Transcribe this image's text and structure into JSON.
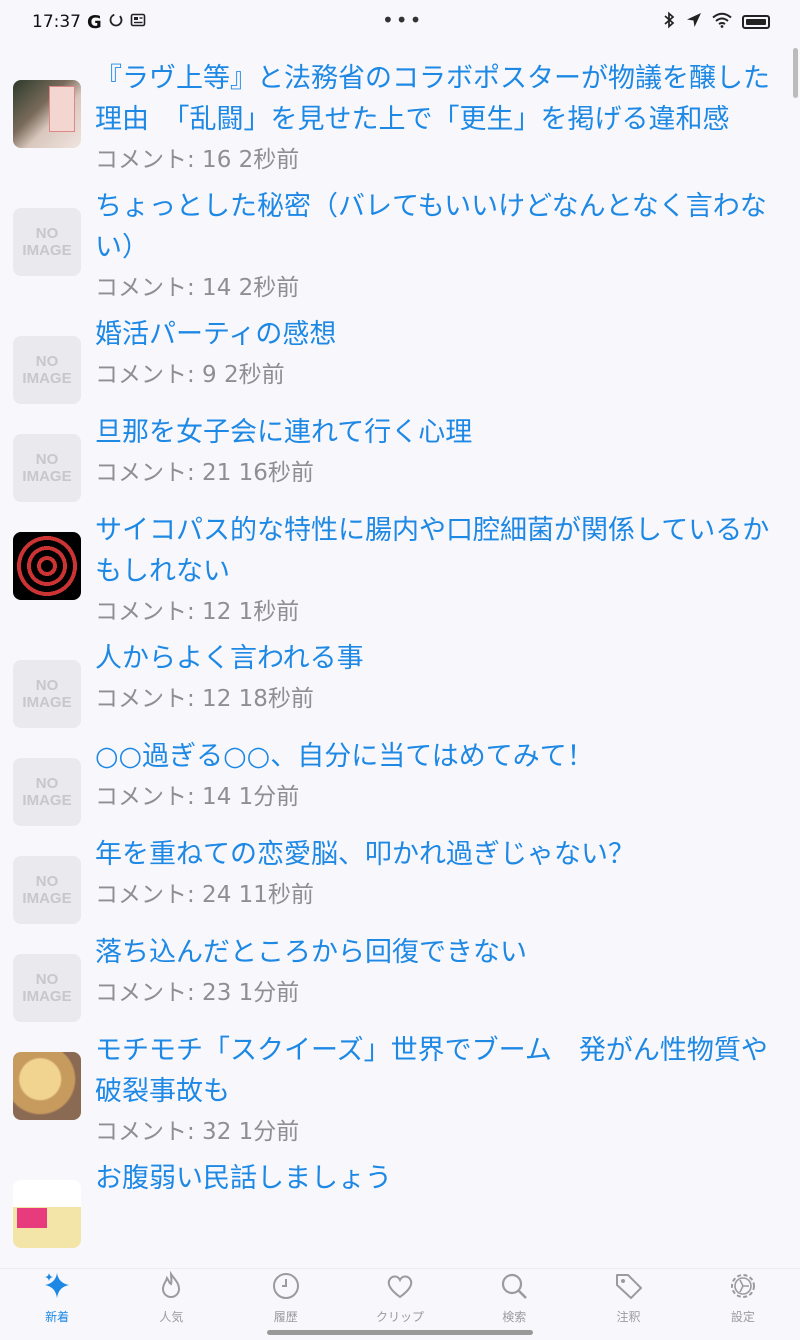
{
  "status": {
    "time": "17:37",
    "g_letter": "G"
  },
  "items": [
    {
      "title": "『ラヴ上等』と法務省のコラボポスターが物議を醸した理由　「乱闘」を見せた上で「更生」を掲げる違和感",
      "meta": "コメント: 16 2秒前",
      "thumb": "image"
    },
    {
      "title": "ちょっとした秘密（バレてもいいけどなんとなく言わない）",
      "meta": "コメント: 14 2秒前",
      "thumb": "noimage"
    },
    {
      "title": "婚活パーティの感想",
      "meta": "コメント: 9 2秒前",
      "thumb": "noimage"
    },
    {
      "title": "旦那を女子会に連れて行く心理",
      "meta": "コメント: 21 16秒前",
      "thumb": "noimage"
    },
    {
      "title": "サイコパス的な特性に腸内や口腔細菌が関係しているかもしれない",
      "meta": "コメント: 12 1秒前",
      "thumb": "image"
    },
    {
      "title": "人からよく言われる事",
      "meta": "コメント: 12 18秒前",
      "thumb": "noimage"
    },
    {
      "title": "○○過ぎる○○、自分に当てはめてみて！",
      "meta": "コメント: 14 1分前",
      "thumb": "noimage"
    },
    {
      "title": "年を重ねての恋愛脳、叩かれ過ぎじゃない？",
      "meta": "コメント: 24 11秒前",
      "thumb": "noimage"
    },
    {
      "title": "落ち込んだところから回復できない",
      "meta": "コメント: 23 1分前",
      "thumb": "noimage"
    },
    {
      "title": "モチモチ「スクイーズ」世界でブーム　発がん性物質や破裂事故も",
      "meta": "コメント: 32 1分前",
      "thumb": "image"
    },
    {
      "title": "お腹弱い民話しましょう",
      "meta": "",
      "thumb": "image"
    }
  ],
  "noimage_text": {
    "line1": "NO",
    "line2": "IMAGE"
  },
  "tabs": [
    {
      "label": "新着",
      "icon": "sparkle-icon",
      "active": true
    },
    {
      "label": "人気",
      "icon": "flame-icon"
    },
    {
      "label": "履歴",
      "icon": "clock-icon"
    },
    {
      "label": "クリップ",
      "icon": "heart-icon"
    },
    {
      "label": "検索",
      "icon": "search-icon"
    },
    {
      "label": "注釈",
      "icon": "tag-icon"
    },
    {
      "label": "設定",
      "icon": "gear-icon"
    }
  ],
  "colors": {
    "accent": "#1e88e5",
    "meta": "#8e8e93",
    "background": "#f8f8fc"
  }
}
